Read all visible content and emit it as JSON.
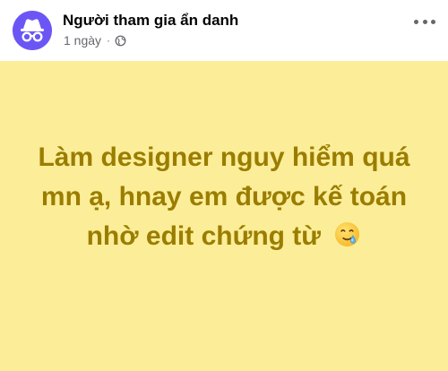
{
  "post": {
    "author": "Người tham gia ẩn danh",
    "time": "1 ngày",
    "separator": "·",
    "privacy_icon": "globe-icon",
    "more_icon": "more-horizontal-icon",
    "avatar_icon": "anonymous-incognito-icon",
    "status_text": "Làm designer nguy hiểm quá mn ạ, hnay em được kế toán nhờ edit chứng từ",
    "emoji_icon": "smiling-face-with-tear-icon"
  },
  "colors": {
    "background_card": "#fcee98",
    "status_text": "#9a7d00",
    "avatar": "#6b56f5"
  }
}
